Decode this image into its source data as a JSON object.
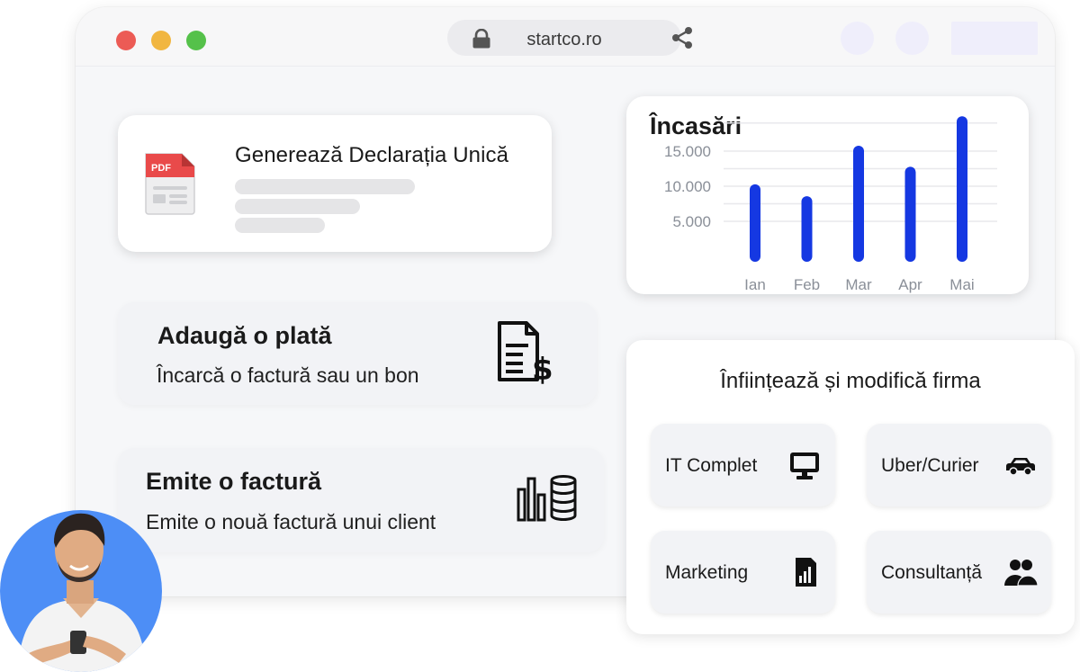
{
  "browser": {
    "url": "startco.ro",
    "window_controls": [
      "close",
      "minimize",
      "maximize"
    ]
  },
  "declaration_card": {
    "title": "Generează Declarația Unică",
    "file_badge": "PDF"
  },
  "payment_card": {
    "title": "Adaugă o plată",
    "subtitle": "Încarcă o factură sau un bon",
    "icon": "invoice-dollar-icon"
  },
  "invoice_card": {
    "title": "Emite o factură",
    "subtitle": "Emite o nouă factură unui client",
    "icon": "bar-chart-coins-icon"
  },
  "revenue_chart": {
    "title": "Încasări"
  },
  "chart_data": {
    "type": "bar",
    "title": "Încasări",
    "categories": [
      "Ian",
      "Feb",
      "Mar",
      "Apr",
      "Mai"
    ],
    "values": [
      9500,
      7800,
      15000,
      12000,
      19200
    ],
    "y_ticks": [
      "15.000",
      "10.000",
      "5.000"
    ],
    "y_tick_values": [
      15000,
      10000,
      5000
    ],
    "ylim": [
      0,
      20000
    ],
    "grid": true,
    "bar_color": "#1538e2"
  },
  "company_section": {
    "title": "Înființează și modifică firma",
    "tiles": [
      {
        "label": "IT Complet",
        "icon": "monitor-icon"
      },
      {
        "label": "Uber/Curier",
        "icon": "car-icon"
      },
      {
        "label": "Marketing",
        "icon": "sim-chart-icon"
      },
      {
        "label": "Consultanță",
        "icon": "people-icon"
      }
    ]
  },
  "colors": {
    "accent_blue": "#1538e2",
    "avatar_bg": "#4d8ef6",
    "pdf_red": "#e94a4a"
  }
}
